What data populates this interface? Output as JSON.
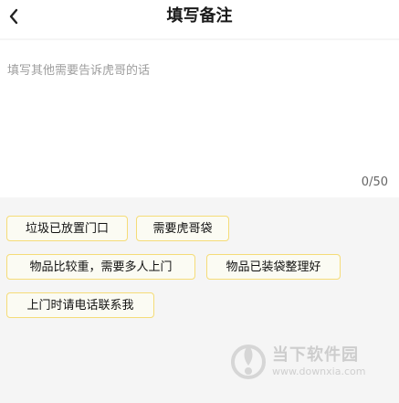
{
  "header": {
    "title": "填写备注"
  },
  "note": {
    "placeholder": "填写其他需要告诉虎哥的话",
    "value": "",
    "counter": "0/50"
  },
  "tags": [
    "垃圾已放置门口",
    "需要虎哥袋",
    "物品比较重，需要多人上门",
    "物品已装袋整理好",
    "上门时请电话联系我"
  ],
  "watermark": {
    "name": "当下软件园",
    "url": "www.downxia.com"
  },
  "colors": {
    "tag_border": "#f5dc78",
    "background": "#f5f5f5"
  },
  "icons": {
    "back": "chevron-left-icon",
    "watermark_logo": "downxia-logo"
  }
}
